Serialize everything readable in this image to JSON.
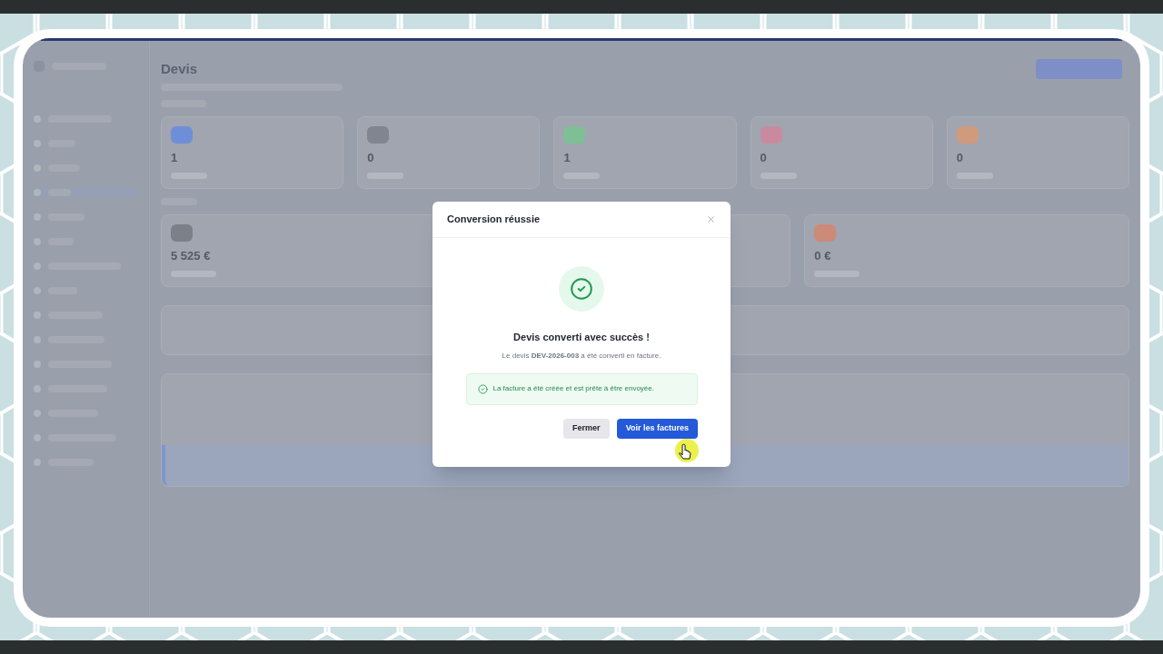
{
  "page": {
    "title": "Devis"
  },
  "stats": [
    {
      "value": "1",
      "color": "#6e8ed8"
    },
    {
      "value": "0",
      "color": "#80858f"
    },
    {
      "value": "1",
      "color": "#7fbf95"
    },
    {
      "value": "0",
      "color": "#c98aa0"
    },
    {
      "value": "0",
      "color": "#d09a7c"
    }
  ],
  "totals": [
    {
      "value": "5 525 €",
      "color": "#7b8089"
    },
    {
      "value": "0 €",
      "color": "#cc8a78"
    }
  ],
  "dialog": {
    "title": "Conversion réussie",
    "heading": "Devis converti avec succès !",
    "message": "Le devis **DEV-2026-003** a été converti en facture.",
    "notice": "La facture a été créée et est prête à être envoyée.",
    "buttons": [
      {
        "label": "Fermer",
        "kind": "secondary"
      },
      {
        "label": "Voir les factures",
        "kind": "primary"
      }
    ]
  }
}
